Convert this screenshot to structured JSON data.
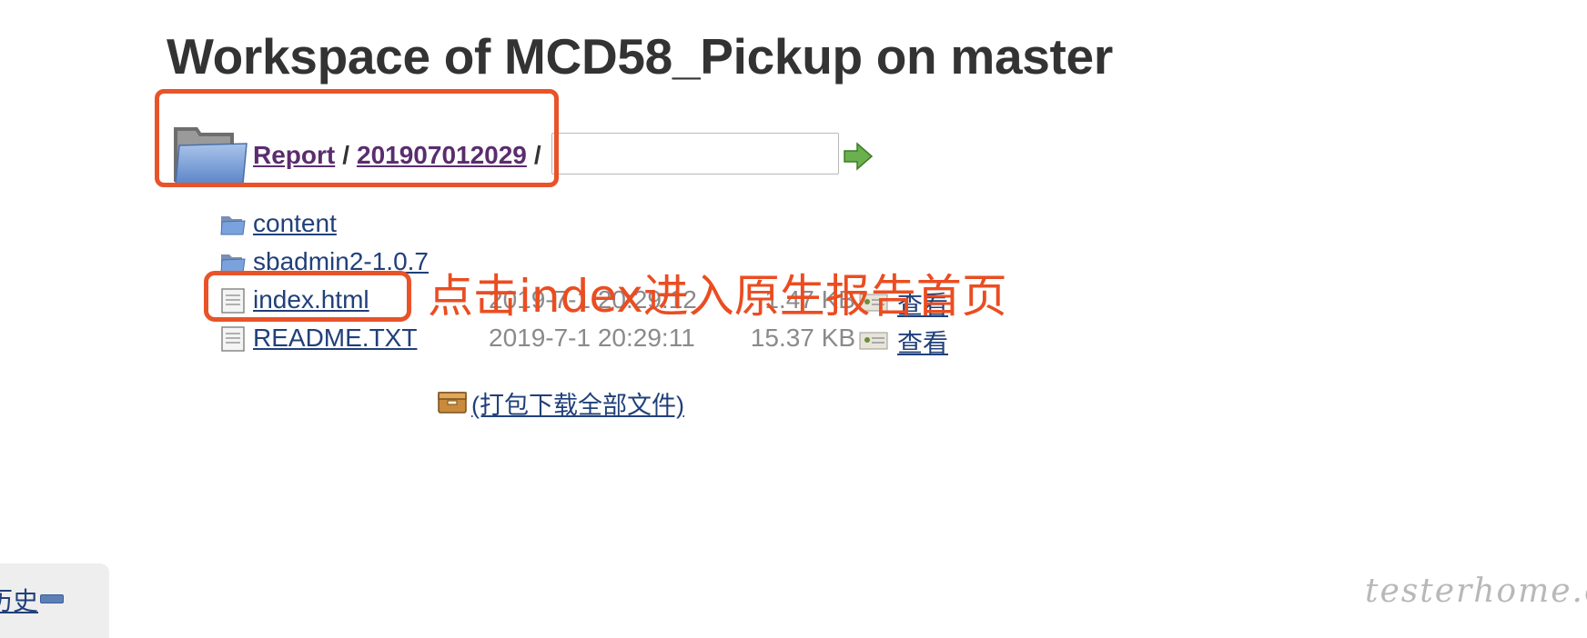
{
  "page": {
    "title": "Workspace of MCD58_Pickup on master"
  },
  "breadcrumb": {
    "items": [
      "Report",
      "201907012029"
    ],
    "separator": "/",
    "path_input_value": ""
  },
  "icons": {
    "big_folder": "folder-icon",
    "go": "green-arrow-icon",
    "folder": "folder-icon",
    "file": "file-icon",
    "view": "view-icon",
    "archive": "archive-icon"
  },
  "entries": [
    {
      "name": "content",
      "type": "folder",
      "date": "",
      "size": "",
      "view": ""
    },
    {
      "name": "sbadmin2-1.0.7",
      "type": "folder",
      "date": "",
      "size": "",
      "view": ""
    },
    {
      "name": "index.html",
      "type": "file",
      "date": "2019-7-1 20:29:12",
      "size": "1.47 KB",
      "view": "查看"
    },
    {
      "name": "README.TXT",
      "type": "file",
      "date": "2019-7-1 20:29:11",
      "size": "15.37 KB",
      "view": "查看"
    }
  ],
  "download_all": "(打包下载全部文件)",
  "annotation": {
    "text": "点击index进入原生报告首页",
    "color": "#ea4d21"
  },
  "side_panel": {
    "label": "历史"
  },
  "watermark": "testerhome.com"
}
